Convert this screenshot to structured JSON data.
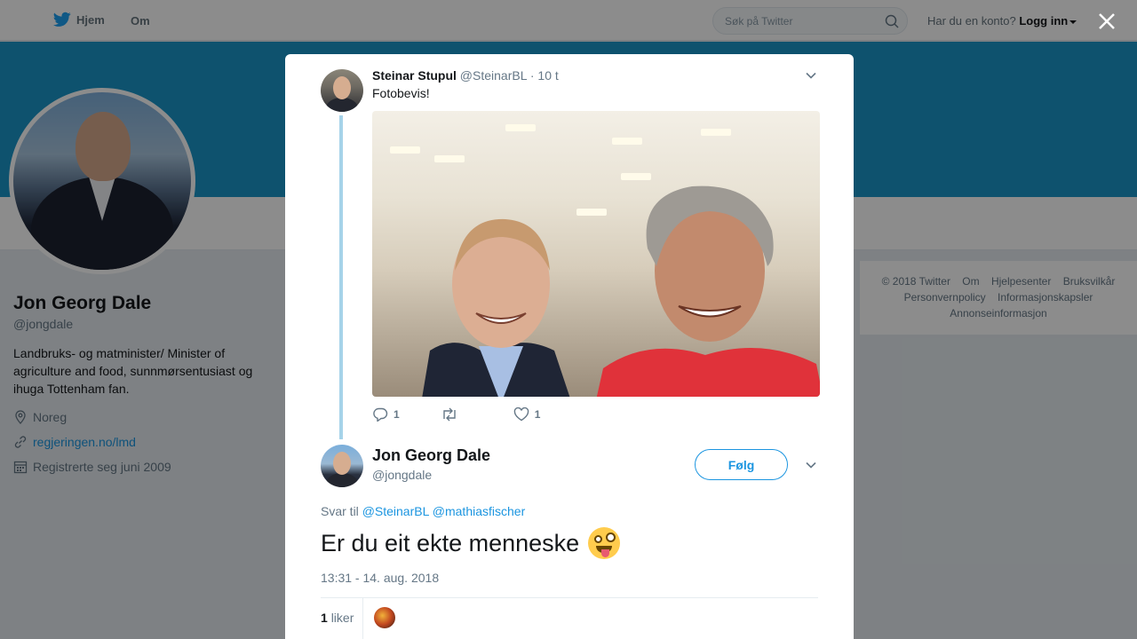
{
  "topbar": {
    "home_label": "Hjem",
    "about_label": "Om",
    "search_placeholder": "Søk på Twitter",
    "account_prompt": "Har du en konto?",
    "login_label": "Logg inn"
  },
  "profile": {
    "name": "Jon Georg Dale",
    "handle": "@jongdale",
    "bio": "Landbruks- og matminister/ Minister of agriculture and food, sunnmørsentusiast og ihuga Tottenham fan.",
    "location": "Noreg",
    "website": "regjeringen.no/lmd",
    "joined": "Registrerte seg juni 2009"
  },
  "footer": {
    "links": [
      "© 2018 Twitter",
      "Om",
      "Hjelpesenter",
      "Bruksvilkår",
      "Personvernpolicy",
      "Informasjonskapsler",
      "Annonseinformasjon"
    ]
  },
  "parent_tweet": {
    "name": "Steinar Stupul",
    "handle": "@SteinarBL",
    "time": "· 10 t",
    "text": "Fotobevis!",
    "reply_count": "1",
    "like_count": "1"
  },
  "main_tweet": {
    "name": "Jon Georg Dale",
    "handle": "@jongdale",
    "follow_label": "Følg",
    "reply_prefix": "Svar til",
    "reply_mentions": [
      "@SteinarBL",
      "@mathiasfischer"
    ],
    "text": "Er du eit ekte menneske",
    "timestamp": "13:31 - 14. aug. 2018",
    "likes_count": "1",
    "likes_label": "liker"
  },
  "colors": {
    "accent": "#1b95e0",
    "banner": "#1b95c8",
    "thread_line": "#a6d3e9"
  }
}
